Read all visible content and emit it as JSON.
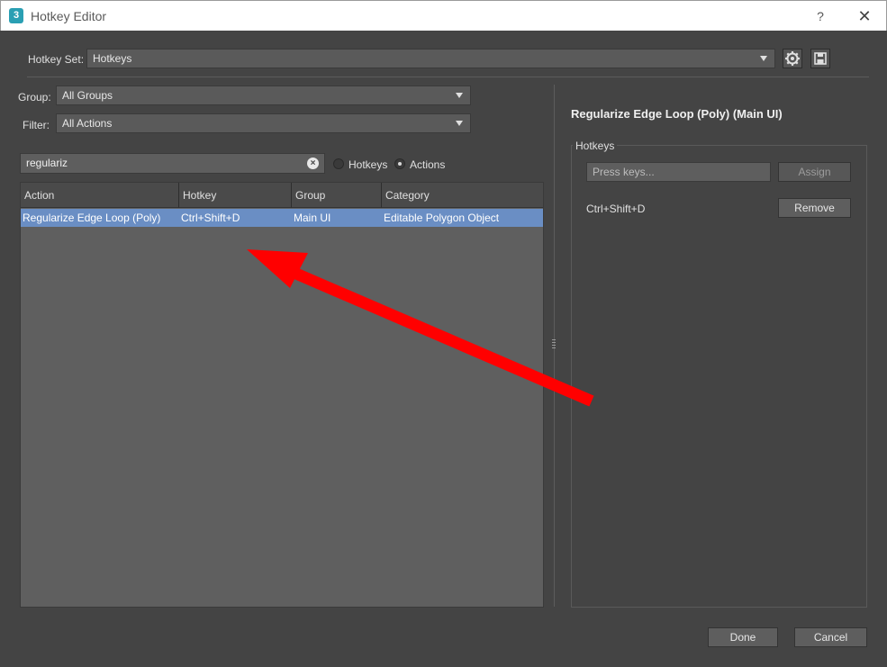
{
  "window": {
    "title": "Hotkey Editor",
    "icon_label": "3",
    "help": "?",
    "close": "✕"
  },
  "hotkey_set": {
    "label": "Hotkey Set:",
    "value": "Hotkeys"
  },
  "toolbar": {
    "settings_icon": "gear-icon",
    "save_icon": "save-icon"
  },
  "group": {
    "label": "Group:",
    "value": "All Groups"
  },
  "filter": {
    "label": "Filter:",
    "value": "All Actions"
  },
  "search": {
    "value": "regulariz",
    "clear": "×"
  },
  "mode": {
    "hotkeys_label": "Hotkeys",
    "actions_label": "Actions",
    "selected": "Actions"
  },
  "table": {
    "columns": [
      "Action",
      "Hotkey",
      "Group",
      "Category"
    ],
    "rows": [
      {
        "action": "Regularize Edge Loop (Poly)",
        "hotkey": "Ctrl+Shift+D",
        "group": "Main UI",
        "category": "Editable Polygon Object"
      }
    ]
  },
  "detail": {
    "title": "Regularize Edge Loop (Poly) (Main UI)",
    "hotkeys_group_label": "Hotkeys",
    "keys_placeholder": "Press keys...",
    "assign_label": "Assign",
    "current_hotkey": "Ctrl+Shift+D",
    "remove_label": "Remove"
  },
  "footer": {
    "done_label": "Done",
    "cancel_label": "Cancel"
  },
  "colors": {
    "background": "#444444",
    "selection": "#6a8ec4",
    "annotation_arrow": "#ff0000"
  }
}
